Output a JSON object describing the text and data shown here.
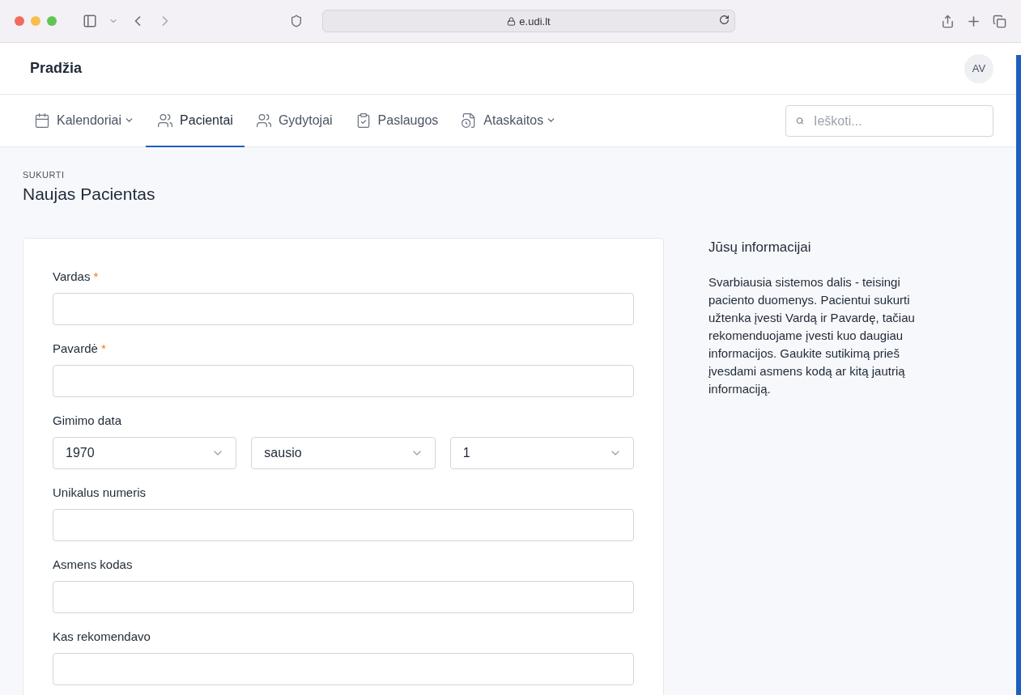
{
  "browser": {
    "url": "e.udi.lt"
  },
  "header": {
    "title": "Pradžia",
    "avatar": "AV"
  },
  "nav": {
    "items": [
      {
        "label": "Kalendoriai",
        "selected": false,
        "dropdown": true
      },
      {
        "label": "Pacientai",
        "selected": true,
        "dropdown": false
      },
      {
        "label": "Gydytojai",
        "selected": false,
        "dropdown": false
      },
      {
        "label": "Paslaugos",
        "selected": false,
        "dropdown": false
      },
      {
        "label": "Ataskaitos",
        "selected": false,
        "dropdown": true
      }
    ],
    "search": {
      "placeholder": "Ieškoti..."
    }
  },
  "page": {
    "eyebrow": "SUKURTI",
    "title": "Naujas Pacientas"
  },
  "form": {
    "fields": [
      {
        "kind": "text",
        "label": "Vardas",
        "required_mark": "*"
      },
      {
        "kind": "text",
        "label": "Pavardė",
        "required_mark": "*"
      },
      {
        "kind": "date",
        "label": "Gimimo data",
        "selects": [
          "1970",
          "sausio",
          "1"
        ]
      },
      {
        "kind": "text",
        "label": "Unikalus numeris"
      },
      {
        "kind": "text",
        "label": "Asmens kodas"
      },
      {
        "kind": "text",
        "label": "Kas rekomendavo"
      }
    ]
  },
  "info": {
    "title": "Jūsų informacijai",
    "text": "Svarbiausia sistemos dalis - teisingi paciento duomenys. Pacientui sukurti užtenka įvesti Vardą ir Pavardę, tačiau rekomenduojame įvesti kuo daugiau informacijos. Gaukite sutikimą prieš įvesdami asmens kodą ar kitą jautrią informaciją."
  }
}
